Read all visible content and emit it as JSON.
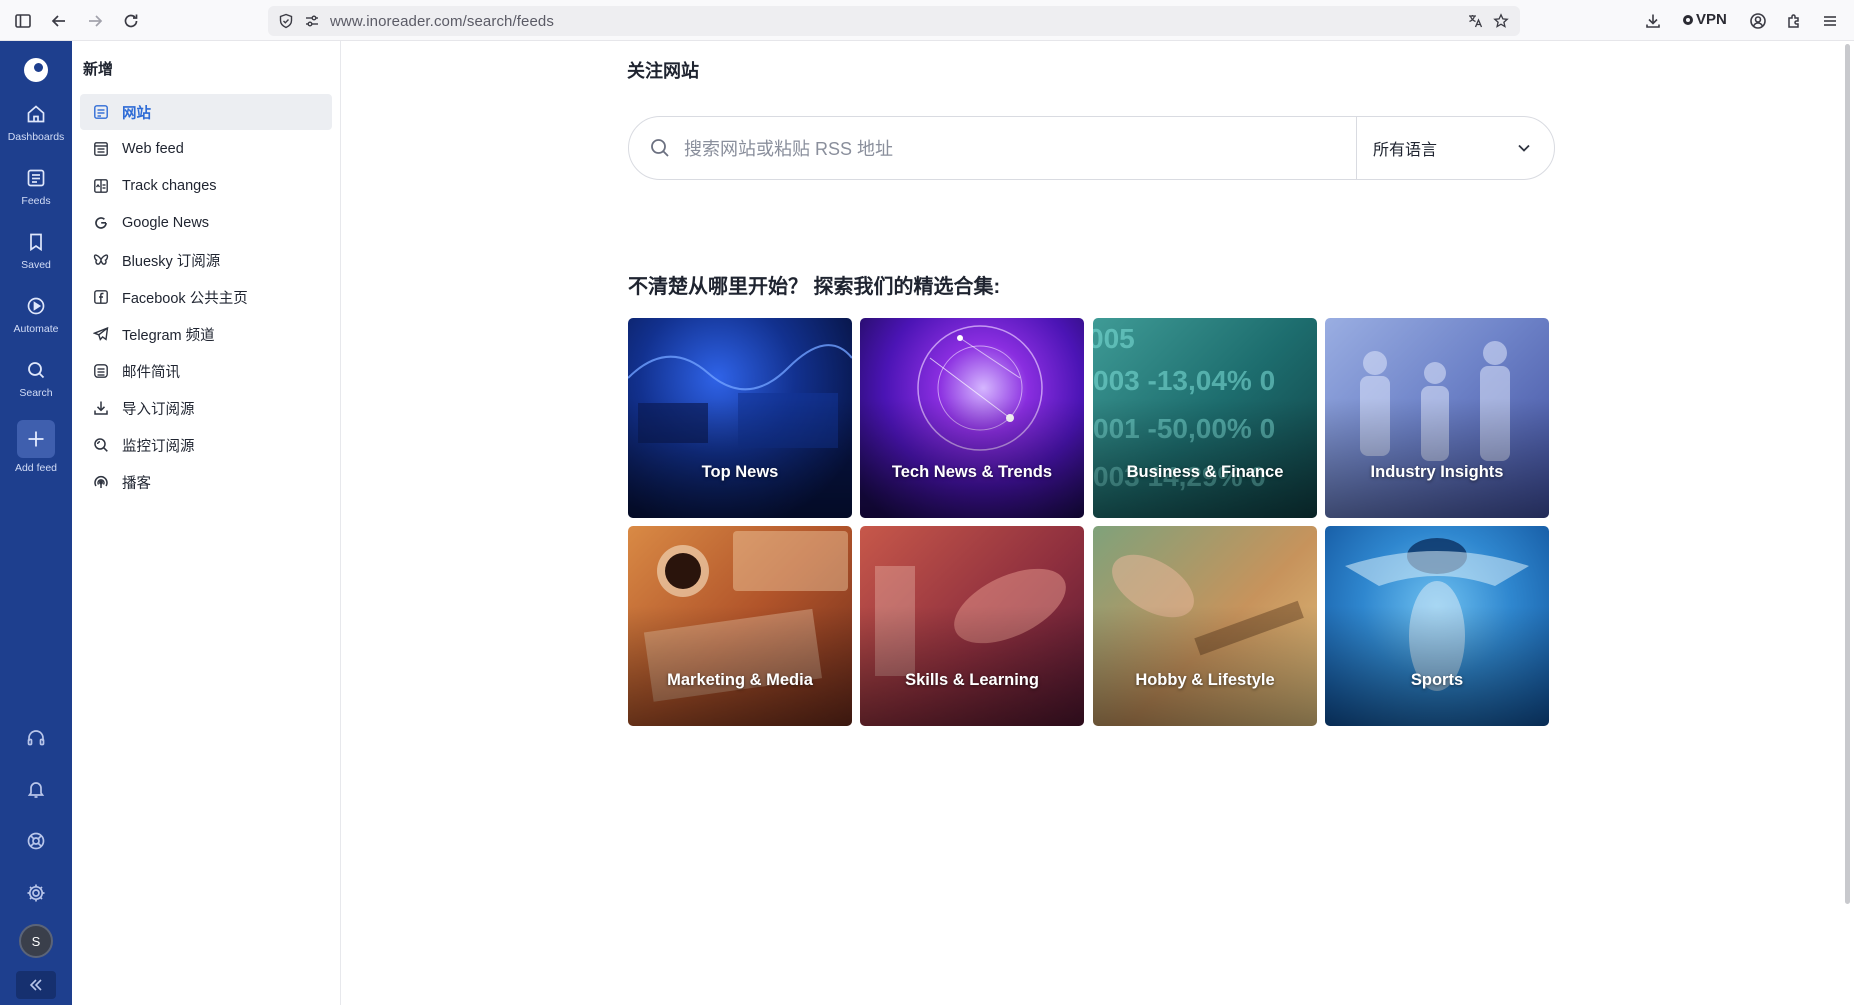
{
  "browser": {
    "url": "www.inoreader.com/search/feeds",
    "vpn_label": "VPN"
  },
  "rail": {
    "items": [
      {
        "label": "Dashboards",
        "icon": "home-icon"
      },
      {
        "label": "Feeds",
        "icon": "feeds-icon"
      },
      {
        "label": "Saved",
        "icon": "bookmark-icon"
      },
      {
        "label": "Automate",
        "icon": "automate-icon"
      },
      {
        "label": "Search",
        "icon": "search-icon"
      },
      {
        "label": "Add feed",
        "icon": "plus-icon"
      }
    ],
    "avatar_initial": "S"
  },
  "side": {
    "title": "新增",
    "items": [
      {
        "label": "网站",
        "icon": "rss-list-icon",
        "active": true
      },
      {
        "label": "Web feed",
        "icon": "web-feed-icon"
      },
      {
        "label": "Track changes",
        "icon": "track-changes-icon"
      },
      {
        "label": "Google News",
        "icon": "google-icon"
      },
      {
        "label": "Bluesky 订阅源",
        "icon": "butterfly-icon"
      },
      {
        "label": "Facebook 公共主页",
        "icon": "facebook-icon"
      },
      {
        "label": "Telegram 频道",
        "icon": "telegram-icon"
      },
      {
        "label": "邮件简讯",
        "icon": "newsletter-icon"
      },
      {
        "label": "导入订阅源",
        "icon": "import-icon"
      },
      {
        "label": "监控订阅源",
        "icon": "monitor-icon"
      },
      {
        "label": "播客",
        "icon": "podcast-icon"
      }
    ]
  },
  "main": {
    "title": "关注网站",
    "search_placeholder": "搜索网站或粘贴 RSS 地址",
    "language_select": "所有语言",
    "collections_title": "不清楚从哪里开始？ 探索我们的精选合集:",
    "collections": [
      {
        "label": "Top News"
      },
      {
        "label": "Tech News & Trends"
      },
      {
        "label": "Business & Finance"
      },
      {
        "label": "Industry Insights"
      },
      {
        "label": "Marketing & Media"
      },
      {
        "label": "Skills & Learning"
      },
      {
        "label": "Hobby & Lifestyle"
      },
      {
        "label": "Sports"
      }
    ]
  },
  "colors": {
    "rail_bg": "#1e3f8e",
    "accent": "#2e6bd6"
  }
}
